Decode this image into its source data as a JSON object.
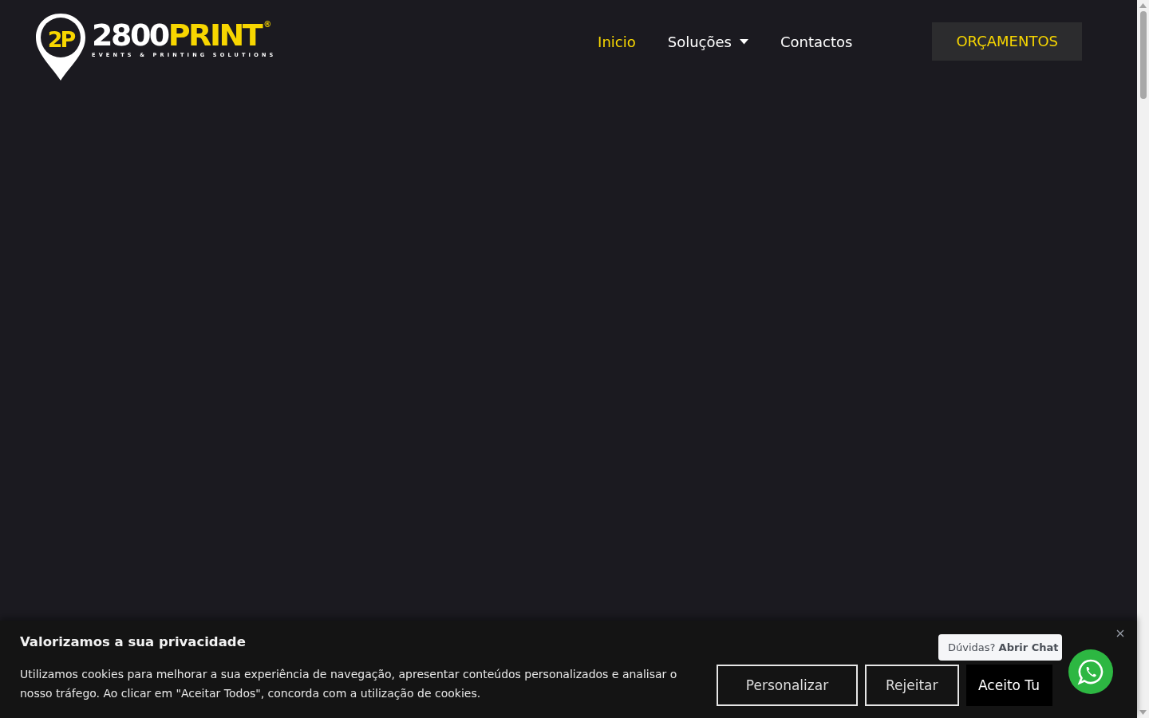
{
  "logo": {
    "mark": "2P",
    "brand_white": "2800",
    "brand_yellow": "PRINT",
    "registered": "®",
    "tagline": "EVENTS & PRINTING SOLUTIONS"
  },
  "nav": {
    "items": [
      {
        "label": "Inicio",
        "selected": true,
        "dropdown": false
      },
      {
        "label": "Soluções",
        "selected": false,
        "dropdown": true
      },
      {
        "label": "Contactos",
        "selected": false,
        "dropdown": false
      }
    ],
    "cta": "ORÇAMENTOS"
  },
  "cookie_banner": {
    "title": "Valorizamos a sua privacidade",
    "text": "Utilizamos cookies para melhorar a sua experiência de navegação, apresentar conteúdos personalizados e analisar o nosso tráfego. Ao clicar em \"Aceitar Todos\", concorda com a utilização de cookies.",
    "buttons": [
      {
        "label": "Personalizar",
        "kind": "outline"
      },
      {
        "label": "Rejeitar",
        "kind": "outline"
      },
      {
        "label": "Aceito Tu",
        "kind": "solid"
      }
    ]
  },
  "chat": {
    "prefix": "Dúvidas?",
    "action": "Abrir Chat"
  }
}
